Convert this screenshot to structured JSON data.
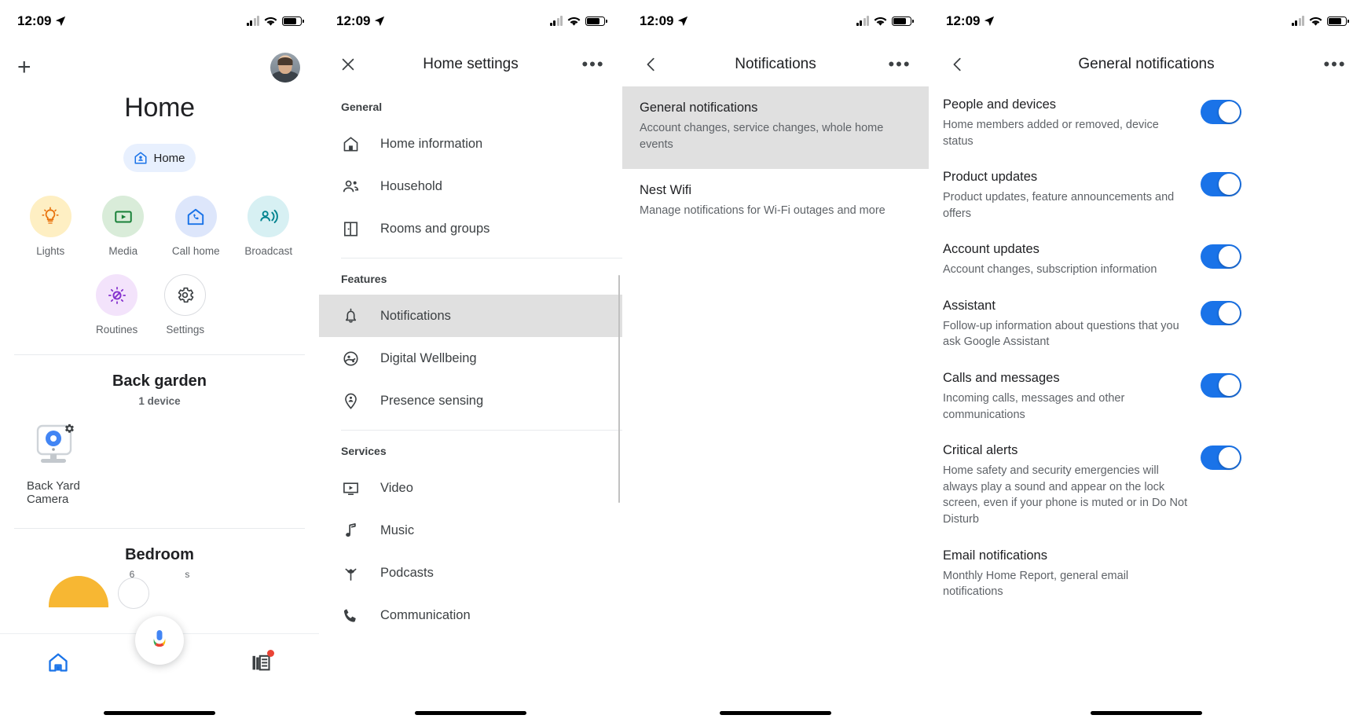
{
  "status_bar": {
    "time": "12:09",
    "location_icon": "location-arrow-icon",
    "signal_icon": "cellular-signal-icon",
    "wifi_icon": "wifi-icon",
    "battery_icon": "battery-icon"
  },
  "colors": {
    "accent_blue": "#1a73e8",
    "chip_bg": "#e8f0fe",
    "highlight": "#e0e0e0",
    "badge_red": "#ea4335"
  },
  "panel1": {
    "add_icon": "plus-icon",
    "avatar_name": "account-avatar",
    "title": "Home",
    "chip": {
      "label": "Home",
      "icon": "home-badge-icon"
    },
    "actions_row1": [
      {
        "label": "Lights",
        "icon": "lightbulb-icon"
      },
      {
        "label": "Media",
        "icon": "media-play-icon"
      },
      {
        "label": "Call home",
        "icon": "call-home-icon"
      },
      {
        "label": "Broadcast",
        "icon": "broadcast-icon"
      }
    ],
    "actions_row2": [
      {
        "label": "Routines",
        "icon": "routines-icon"
      },
      {
        "label": "Settings",
        "icon": "gear-icon"
      }
    ],
    "room": {
      "name": "Back garden",
      "device_count": "1 device",
      "device_name": "Back Yard Camera",
      "device_icon": "camera-with-gear-icon"
    },
    "bedroom": {
      "name": "Bedroom",
      "left_value": "6",
      "right_value": "s"
    },
    "tabbar": {
      "home_icon": "home-icon",
      "feed_icon": "feed-icon",
      "assistant_icon": "assistant-mic-icon"
    }
  },
  "panel2": {
    "close_icon": "close-icon",
    "title": "Home settings",
    "overflow_icon": "more-options-icon",
    "sections": [
      {
        "header": "General",
        "items": [
          {
            "label": "Home information",
            "icon": "home-outline-icon"
          },
          {
            "label": "Household",
            "icon": "people-icon"
          },
          {
            "label": "Rooms and groups",
            "icon": "door-icon"
          }
        ]
      },
      {
        "header": "Features",
        "items": [
          {
            "label": "Notifications",
            "icon": "bell-icon",
            "highlighted": true
          },
          {
            "label": "Digital Wellbeing",
            "icon": "digital-wellbeing-icon"
          },
          {
            "label": "Presence sensing",
            "icon": "presence-pin-icon"
          }
        ]
      },
      {
        "header": "Services",
        "items": [
          {
            "label": "Video",
            "icon": "video-icon"
          },
          {
            "label": "Music",
            "icon": "music-note-icon"
          },
          {
            "label": "Podcasts",
            "icon": "podcast-icon"
          },
          {
            "label": "Communication",
            "icon": "phone-icon"
          }
        ]
      }
    ]
  },
  "panel3": {
    "back_icon": "back-chevron-icon",
    "title": "Notifications",
    "overflow_icon": "more-options-icon",
    "items": [
      {
        "title": "General notifications",
        "subtitle": "Account changes, service changes, whole home events",
        "highlighted": true
      },
      {
        "title": "Nest Wifi",
        "subtitle": "Manage notifications for Wi-Fi outages and more",
        "highlighted": false
      }
    ]
  },
  "panel4": {
    "back_icon": "back-chevron-icon",
    "title": "General notifications",
    "overflow_icon": "more-options-icon",
    "rows": [
      {
        "title": "People and devices",
        "subtitle": "Home members added or removed, device status",
        "toggle": "on"
      },
      {
        "title": "Product updates",
        "subtitle": "Product updates, feature announcements and offers",
        "toggle": "on"
      },
      {
        "title": "Account updates",
        "subtitle": "Account changes, subscription information",
        "toggle": "on"
      },
      {
        "title": "Assistant",
        "subtitle": "Follow-up information about questions that you ask Google Assistant",
        "toggle": "on"
      },
      {
        "title": "Calls and messages",
        "subtitle": "Incoming calls, messages and other communications",
        "toggle": "on"
      },
      {
        "title": "Critical alerts",
        "subtitle": "Home safety and security emergencies will always play a sound and appear on the lock screen, even if your phone is muted or in Do Not Disturb",
        "toggle": "on"
      },
      {
        "title": "Email notifications",
        "subtitle": "Monthly Home Report, general email notifications",
        "toggle": "none"
      }
    ]
  }
}
